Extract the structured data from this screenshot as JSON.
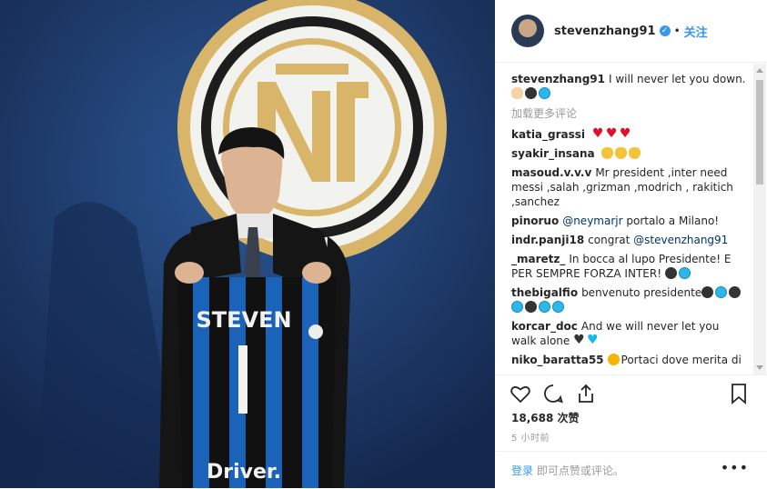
{
  "photo": {
    "jersey_name": "STEVEN",
    "jersey_number": "1",
    "sponsor": "Driver."
  },
  "header": {
    "username": "stevenzhang91",
    "verified_mark": "✓",
    "dot": "•",
    "follow_label": "关注"
  },
  "caption": {
    "username": "stevenzhang91",
    "text": "I will never let you down."
  },
  "load_more_label": "加载更多评论",
  "comments": [
    {
      "user": "katia_grassi",
      "text": ""
    },
    {
      "user": "syakir_insana",
      "text": ""
    },
    {
      "user": "masoud.v.v.v",
      "text": "Mr president ,inter need messi ,salah ,grizman ,modrich , rakitich ,sanchez"
    },
    {
      "user": "pinoruo",
      "mention": "@neymarjr",
      "text": " portalo a Milano!"
    },
    {
      "user": "indr.panji18",
      "text": "congrat ",
      "mention": "@stevenzhang91"
    },
    {
      "user": "_maretz_",
      "text": "In bocca al lupo Presidente! E PER SEMPRE FORZA INTER!"
    },
    {
      "user": "thebigalfio",
      "text": "benvenuto presidente"
    },
    {
      "user": "korcar_doc",
      "text": "And we will never let you walk alone"
    },
    {
      "user": "niko_baratta55",
      "text": "Portaci dove merita di"
    }
  ],
  "likes": {
    "count": "18,688",
    "label": "次赞"
  },
  "timestamp": "5 小时前",
  "footer": {
    "login_link": "登录",
    "login_text": " 即可点赞或评论。",
    "more": "•••"
  },
  "colors": {
    "accent": "#3897f0",
    "inter_blue": "#1a63b8"
  }
}
